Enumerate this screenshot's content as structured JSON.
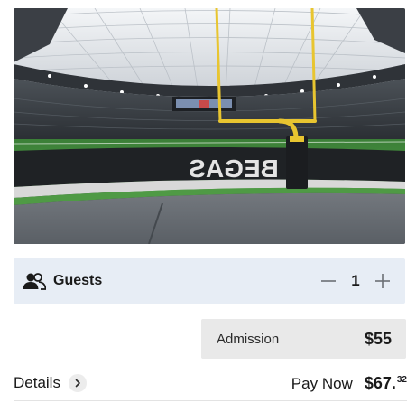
{
  "photo": {
    "alt_icon": "stadium-photo",
    "end_zone_text": "BEGAS"
  },
  "guests": {
    "icon": "people-icon",
    "label": "Guests",
    "quantity": "1",
    "decrement_icon": "minus-icon",
    "increment_icon": "plus-icon"
  },
  "admission": {
    "label": "Admission",
    "price": "$55"
  },
  "footer": {
    "details_label": "Details",
    "details_icon": "chevron-right-icon",
    "pay_now_label": "Pay Now",
    "total_main": "$67.",
    "total_cents": "32"
  },
  "colors": {
    "guests_bg": "#e7edf5",
    "admission_bg": "#e9e9e9",
    "goalpost": "#e8c530",
    "field": "#3f8a3c"
  }
}
